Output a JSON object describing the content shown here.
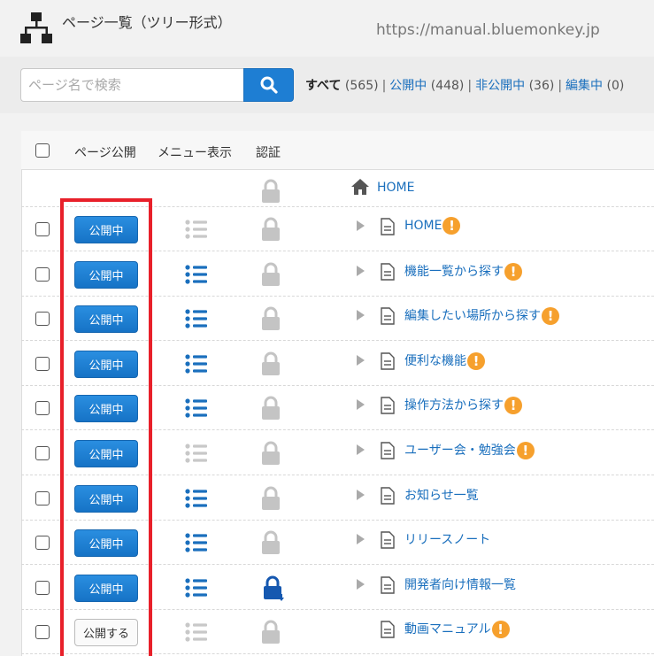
{
  "header": {
    "title": "ページ一覧（ツリー形式）",
    "url": "https://manual.bluemonkey.jp"
  },
  "search": {
    "placeholder": "ページ名で検索",
    "value": ""
  },
  "filters": {
    "all_label": "すべて",
    "all_count": "(565)",
    "public_label": "公開中",
    "public_count": "(448)",
    "private_label": "非公開中",
    "private_count": "(36)",
    "editing_label": "編集中",
    "editing_count": "(0)"
  },
  "table": {
    "headers": {
      "publish": "ページ公開",
      "menu": "メニュー表示",
      "auth": "認証"
    },
    "home_row": {
      "label": "HOME"
    },
    "rows": [
      {
        "publish_label": "公開中",
        "published": true,
        "menu_visible": false,
        "lock": "gray",
        "expandable": true,
        "title": "HOME",
        "warning": true
      },
      {
        "publish_label": "公開中",
        "published": true,
        "menu_visible": true,
        "lock": "gray",
        "expandable": true,
        "title": "機能一覧から探す",
        "warning": true
      },
      {
        "publish_label": "公開中",
        "published": true,
        "menu_visible": true,
        "lock": "gray",
        "expandable": true,
        "title": "編集したい場所から探す",
        "warning": true
      },
      {
        "publish_label": "公開中",
        "published": true,
        "menu_visible": true,
        "lock": "gray",
        "expandable": true,
        "title": "便利な機能",
        "warning": true
      },
      {
        "publish_label": "公開中",
        "published": true,
        "menu_visible": true,
        "lock": "gray",
        "expandable": true,
        "title": "操作方法から探す",
        "warning": true
      },
      {
        "publish_label": "公開中",
        "published": true,
        "menu_visible": false,
        "lock": "gray",
        "expandable": true,
        "title": "ユーザー会・勉強会",
        "warning": true
      },
      {
        "publish_label": "公開中",
        "published": true,
        "menu_visible": true,
        "lock": "gray",
        "expandable": true,
        "title": "お知らせ一覧",
        "warning": false
      },
      {
        "publish_label": "公開中",
        "published": true,
        "menu_visible": true,
        "lock": "gray",
        "expandable": true,
        "title": "リリースノート",
        "warning": false
      },
      {
        "publish_label": "公開中",
        "published": true,
        "menu_visible": true,
        "lock": "blue",
        "expandable": true,
        "title": "開発者向け情報一覧",
        "warning": false
      },
      {
        "publish_label": "公開する",
        "published": false,
        "menu_visible": false,
        "lock": "gray",
        "expandable": false,
        "title": "動画マニュアル",
        "warning": true
      }
    ]
  },
  "colors": {
    "accent": "#1e7ed3",
    "link": "#1a6fbd",
    "warning": "#f6a02d",
    "highlight": "#e8202a"
  }
}
